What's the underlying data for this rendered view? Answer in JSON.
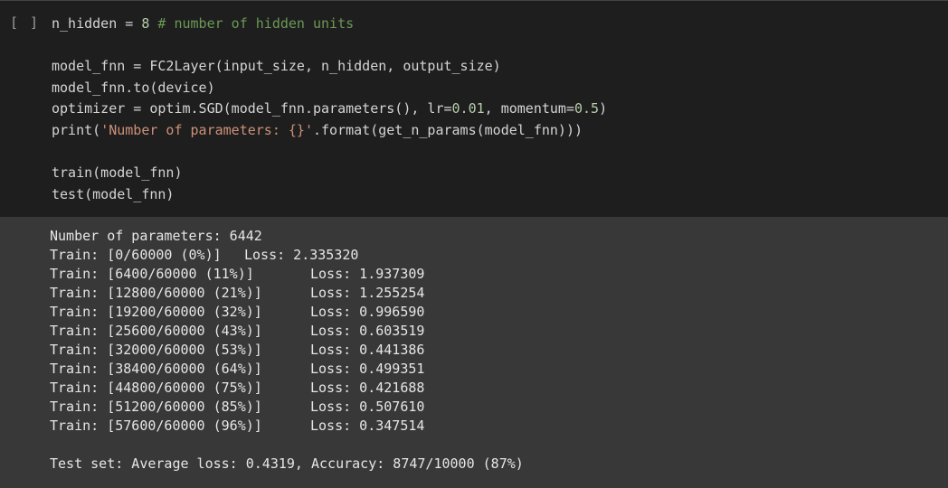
{
  "cell": {
    "run_indicator": "[ ]"
  },
  "code": {
    "line1": {
      "var": "n_hidden",
      "op": " = ",
      "num": "8",
      "comment": " # number of hidden units"
    },
    "line2": {
      "lhs": "model_fnn",
      "op": " = ",
      "rhs": "FC2Layer(input_size, n_hidden, output_size)"
    },
    "line3": "model_fnn.to(device)",
    "line4": {
      "lhs": "optimizer",
      "op": " = ",
      "pre": "optim.SGD(model_fnn.parameters(), lr=",
      "lr": "0.01",
      "mid": ", momentum=",
      "momentum": "0.5",
      "post": ")"
    },
    "line5": {
      "pre": "print(",
      "str": "'Number of parameters: {}'",
      "post": ".format(get_n_params(model_fnn)))"
    },
    "line6": "train(model_fnn)",
    "line7": "test(model_fnn)"
  },
  "output": {
    "params_line": "Number of parameters: 6442",
    "train_rows": [
      {
        "progress": "Train: [0/60000 (0%)]",
        "loss": "Loss: 2.335320"
      },
      {
        "progress": "Train: [6400/60000 (11%)]",
        "loss": "Loss: 1.937309"
      },
      {
        "progress": "Train: [12800/60000 (21%)]",
        "loss": "Loss: 1.255254"
      },
      {
        "progress": "Train: [19200/60000 (32%)]",
        "loss": "Loss: 0.996590"
      },
      {
        "progress": "Train: [25600/60000 (43%)]",
        "loss": "Loss: 0.603519"
      },
      {
        "progress": "Train: [32000/60000 (53%)]",
        "loss": "Loss: 0.441386"
      },
      {
        "progress": "Train: [38400/60000 (64%)]",
        "loss": "Loss: 0.499351"
      },
      {
        "progress": "Train: [44800/60000 (75%)]",
        "loss": "Loss: 0.421688"
      },
      {
        "progress": "Train: [51200/60000 (85%)]",
        "loss": "Loss: 0.507610"
      },
      {
        "progress": "Train: [57600/60000 (96%)]",
        "loss": "Loss: 0.347514"
      }
    ],
    "test_line": "Test set: Average loss: 0.4319, Accuracy: 8747/10000 (87%)"
  },
  "colors": {
    "code_bg": "#1e1e1e",
    "output_bg": "#383838",
    "number": "#b5cea8",
    "comment": "#6a9955",
    "string": "#ce9178"
  }
}
